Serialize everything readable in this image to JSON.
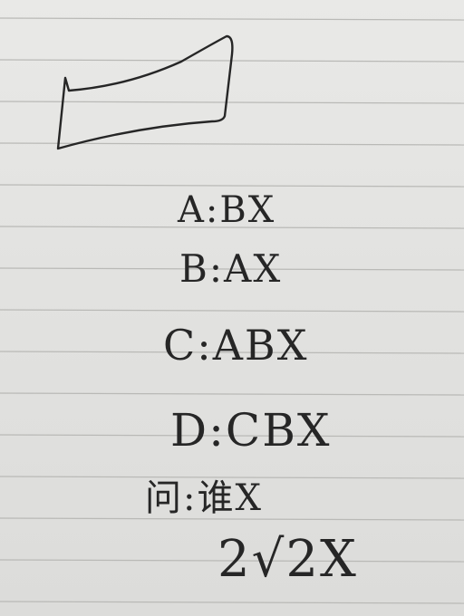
{
  "notes": {
    "line_a": "A:BX",
    "line_b": "B:AX",
    "line_c": "C:ABX",
    "line_d": "D:CBX",
    "line_q": "问:谁X",
    "score": "2√2X"
  },
  "colors": {
    "paper": "#e4e4e2",
    "rule_line": "#b9b9b6",
    "ink": "#262626"
  }
}
